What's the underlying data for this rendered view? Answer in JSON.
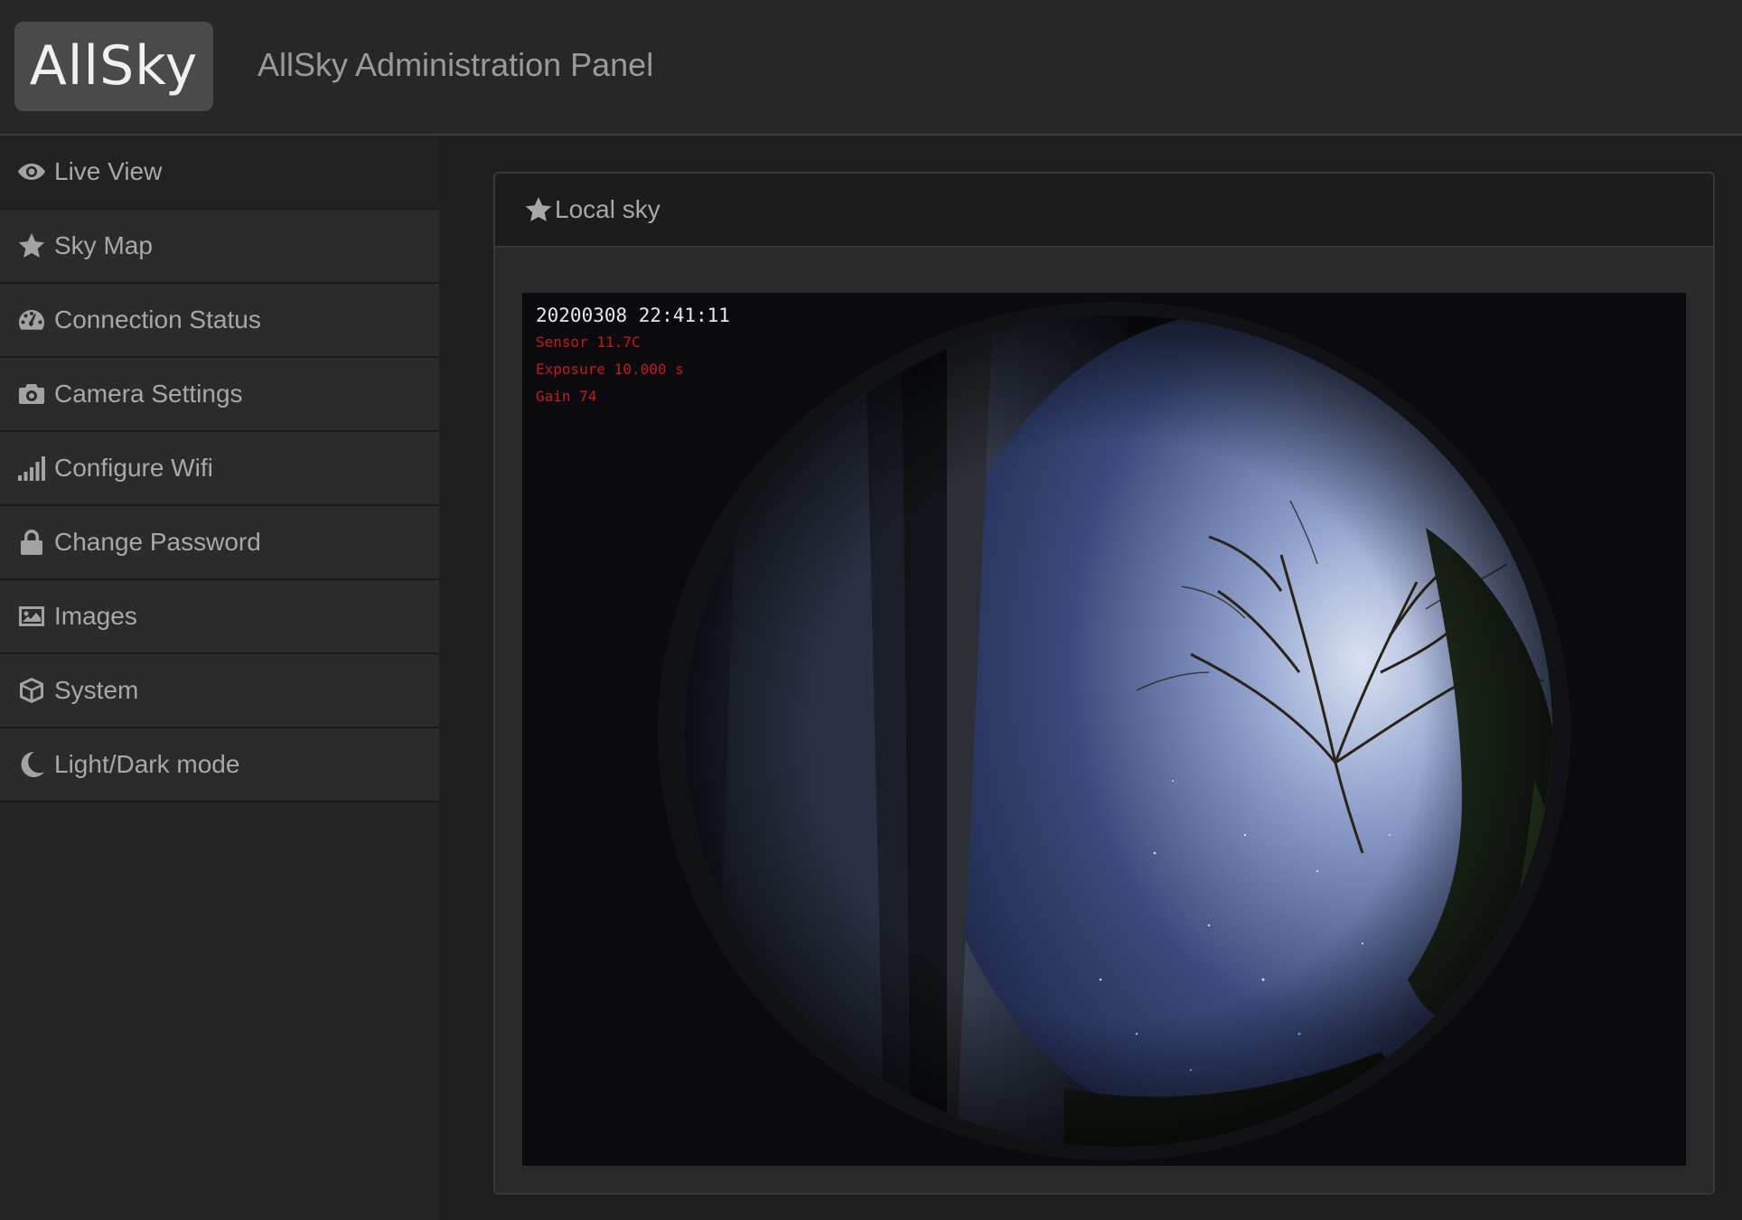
{
  "header": {
    "brand": "AllSky",
    "title": "AllSky Administration Panel"
  },
  "sidebar": {
    "items": [
      {
        "label": "Live View",
        "icon": "eye-icon",
        "active": true
      },
      {
        "label": "Sky Map",
        "icon": "star-icon",
        "active": false
      },
      {
        "label": "Connection Status",
        "icon": "dashboard-icon",
        "active": false
      },
      {
        "label": "Camera Settings",
        "icon": "camera-icon",
        "active": false
      },
      {
        "label": "Configure Wifi",
        "icon": "signal-icon",
        "active": false
      },
      {
        "label": "Change Password",
        "icon": "lock-icon",
        "active": false
      },
      {
        "label": "Images",
        "icon": "image-icon",
        "active": false
      },
      {
        "label": "System",
        "icon": "cube-icon",
        "active": false
      },
      {
        "label": "Light/Dark mode",
        "icon": "moon-icon",
        "active": false
      }
    ]
  },
  "main": {
    "panel_title": "Local sky",
    "panel_icon": "star-icon",
    "image": {
      "timestamp": "20200308 22:41:11",
      "sensor": "Sensor 11.7C",
      "exposure": "Exposure 10.000 s",
      "gain": "Gain 74"
    }
  },
  "colors": {
    "header_bg": "#272727",
    "sidebar_bg": "#2b2b2b",
    "panel_bg": "#2a2a2a",
    "text_muted": "#a8a8a8",
    "overlay_red": "#c41a1a"
  }
}
